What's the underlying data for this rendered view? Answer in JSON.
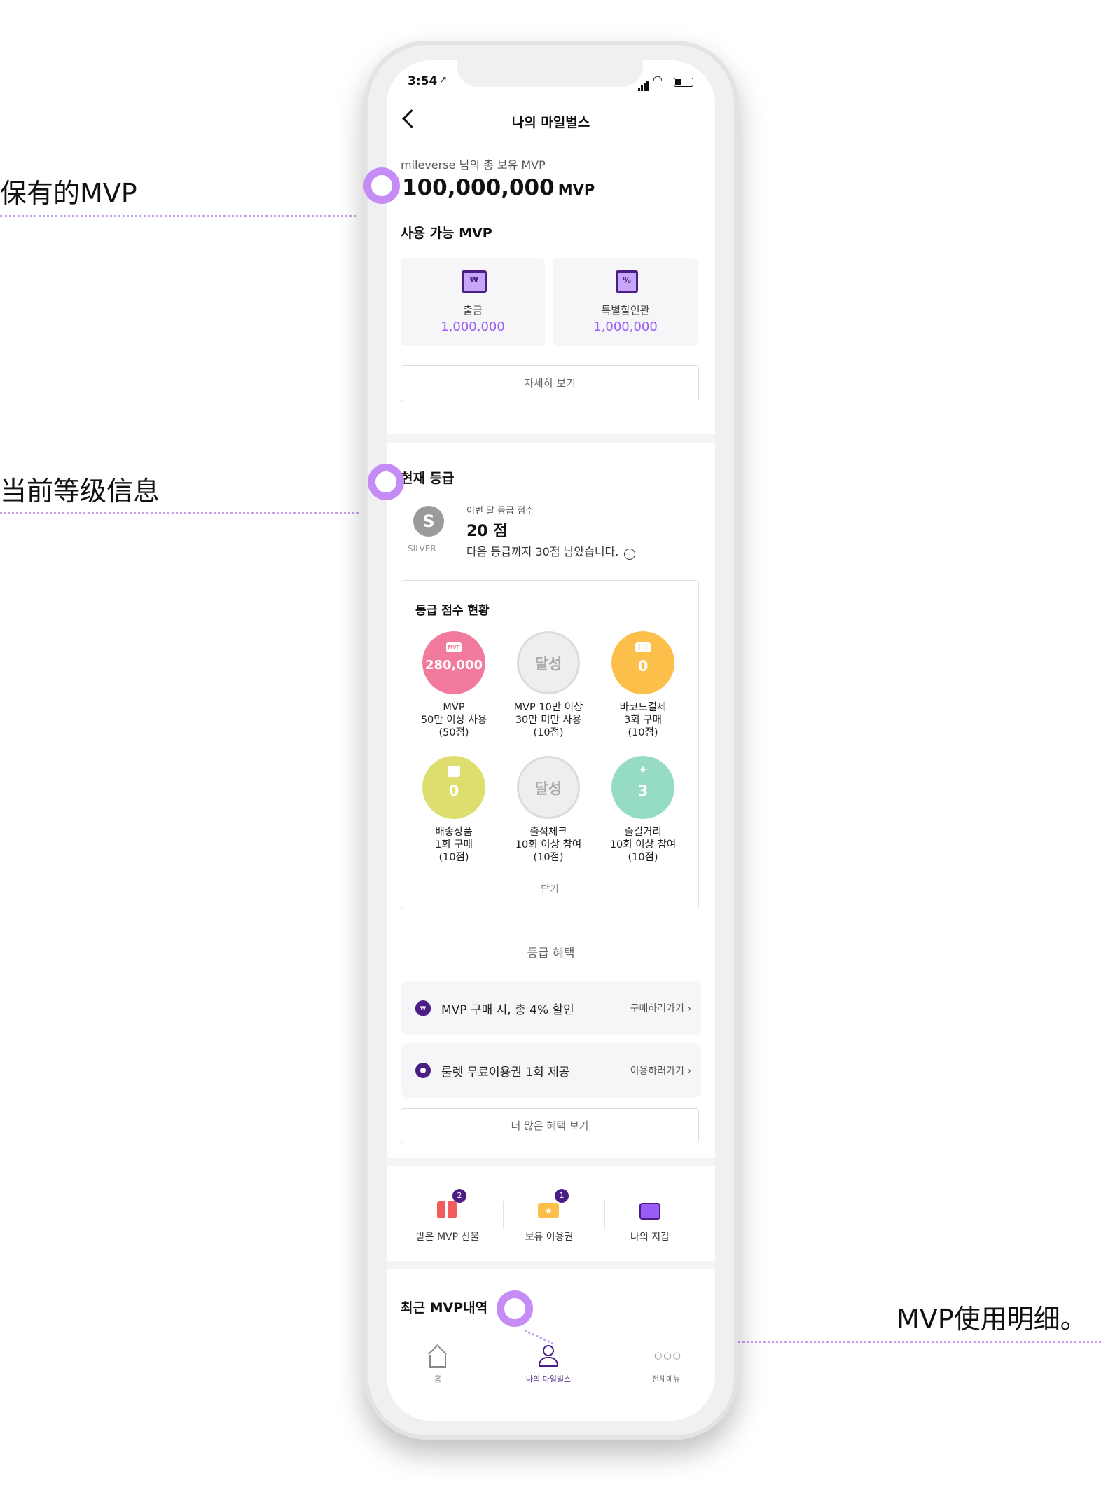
{
  "annotations": {
    "owned_mvp": "保有的MVP",
    "current_grade": "当前等级信息",
    "mvp_history": "MVP使用明细。"
  },
  "status_bar": {
    "time": "3:54"
  },
  "header": {
    "title": "나의 마일벌스"
  },
  "summary": {
    "owner_line": "mileverse 님의 총 보유 MVP",
    "total": "100,000,000",
    "unit": "MVP"
  },
  "usable": {
    "title": "사용 가능 MVP",
    "items": [
      {
        "label": "출금",
        "value": "1,000,000"
      },
      {
        "label": "특별할인관",
        "value": "1,000,000"
      }
    ],
    "detail_button": "자세히 보기"
  },
  "grade": {
    "title": "현재 등급",
    "badge_letter": "S",
    "badge_name": "SILVER",
    "score_caption": "이번 달 등급 점수",
    "score": "20 점",
    "next_info": "다음 등급까지 30점 남았습니다.",
    "status_title": "등급 점수 현황",
    "items": [
      {
        "value": "280,000",
        "badge": "MVP",
        "lines": [
          "MVP",
          "50만 이상 사용",
          "(50점)"
        ],
        "color": "#f27b9d"
      },
      {
        "value": "달성",
        "lines": [
          "MVP 10만 이상",
          "30만 미만 사용",
          "(10점)"
        ],
        "color": "#eeeeee"
      },
      {
        "value": "0",
        "lines": [
          "바코드결제",
          "3회 구매",
          "(10점)"
        ],
        "color": "#fbbf4a"
      },
      {
        "value": "0",
        "lines": [
          "배송상품",
          "1회 구매",
          "(10점)"
        ],
        "color": "#dede6e"
      },
      {
        "value": "달성",
        "lines": [
          "출석체크",
          "10회 이상 참여",
          "(10점)"
        ],
        "color": "#eeeeee"
      },
      {
        "value": "3",
        "lines": [
          "즐길거리",
          "10회 이상 참여",
          "(10점)"
        ],
        "color": "#95dcc3"
      }
    ],
    "close": "닫기"
  },
  "benefits": {
    "title": "등급 혜택",
    "items": [
      {
        "text": "MVP 구매 시, 총 4% 할인",
        "action": "구매하러가기"
      },
      {
        "text": "룰렛 무료이용권 1회 제공",
        "action": "이용하러가기"
      }
    ],
    "more_button": "더 많은 혜택 보기"
  },
  "quick_menu": [
    {
      "label": "받은 MVP 선물",
      "count": "2"
    },
    {
      "label": "보유 이용권",
      "count": "1"
    },
    {
      "label": "나의 지갑"
    }
  ],
  "recent": {
    "title": "최근 MVP내역"
  },
  "tabbar": [
    {
      "label": "홈"
    },
    {
      "label": "나의 마일벌스"
    },
    {
      "label": "전체메뉴"
    }
  ],
  "colors": {
    "accent": "#9b5cf6",
    "brand_dark": "#4b1e86",
    "annotation": "#c68cf5"
  }
}
